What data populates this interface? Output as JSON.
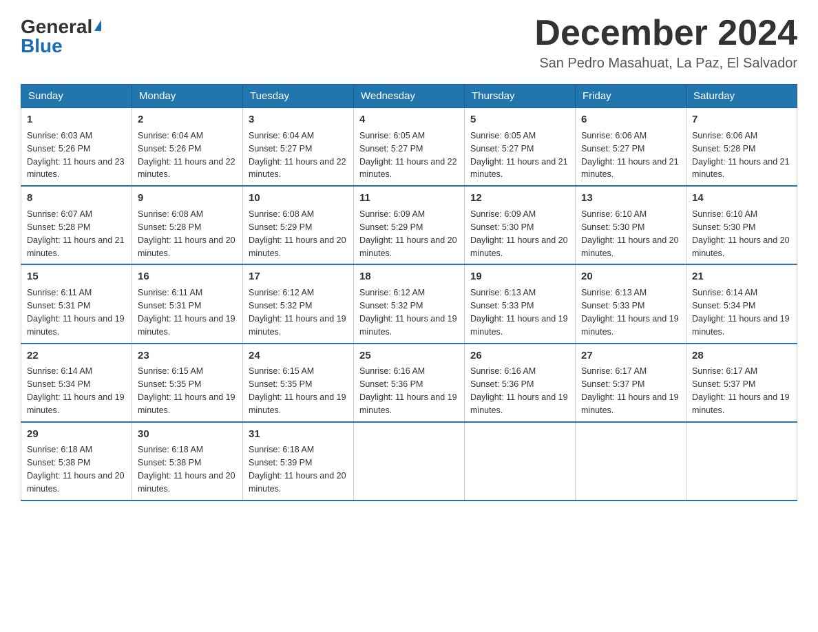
{
  "header": {
    "logo_general": "General",
    "logo_blue": "Blue",
    "title": "December 2024",
    "subtitle": "San Pedro Masahuat, La Paz, El Salvador"
  },
  "weekdays": [
    "Sunday",
    "Monday",
    "Tuesday",
    "Wednesday",
    "Thursday",
    "Friday",
    "Saturday"
  ],
  "weeks": [
    [
      {
        "day": "1",
        "sunrise": "6:03 AM",
        "sunset": "5:26 PM",
        "daylight": "11 hours and 23 minutes."
      },
      {
        "day": "2",
        "sunrise": "6:04 AM",
        "sunset": "5:26 PM",
        "daylight": "11 hours and 22 minutes."
      },
      {
        "day": "3",
        "sunrise": "6:04 AM",
        "sunset": "5:27 PM",
        "daylight": "11 hours and 22 minutes."
      },
      {
        "day": "4",
        "sunrise": "6:05 AM",
        "sunset": "5:27 PM",
        "daylight": "11 hours and 22 minutes."
      },
      {
        "day": "5",
        "sunrise": "6:05 AM",
        "sunset": "5:27 PM",
        "daylight": "11 hours and 21 minutes."
      },
      {
        "day": "6",
        "sunrise": "6:06 AM",
        "sunset": "5:27 PM",
        "daylight": "11 hours and 21 minutes."
      },
      {
        "day": "7",
        "sunrise": "6:06 AM",
        "sunset": "5:28 PM",
        "daylight": "11 hours and 21 minutes."
      }
    ],
    [
      {
        "day": "8",
        "sunrise": "6:07 AM",
        "sunset": "5:28 PM",
        "daylight": "11 hours and 21 minutes."
      },
      {
        "day": "9",
        "sunrise": "6:08 AM",
        "sunset": "5:28 PM",
        "daylight": "11 hours and 20 minutes."
      },
      {
        "day": "10",
        "sunrise": "6:08 AM",
        "sunset": "5:29 PM",
        "daylight": "11 hours and 20 minutes."
      },
      {
        "day": "11",
        "sunrise": "6:09 AM",
        "sunset": "5:29 PM",
        "daylight": "11 hours and 20 minutes."
      },
      {
        "day": "12",
        "sunrise": "6:09 AM",
        "sunset": "5:30 PM",
        "daylight": "11 hours and 20 minutes."
      },
      {
        "day": "13",
        "sunrise": "6:10 AM",
        "sunset": "5:30 PM",
        "daylight": "11 hours and 20 minutes."
      },
      {
        "day": "14",
        "sunrise": "6:10 AM",
        "sunset": "5:30 PM",
        "daylight": "11 hours and 20 minutes."
      }
    ],
    [
      {
        "day": "15",
        "sunrise": "6:11 AM",
        "sunset": "5:31 PM",
        "daylight": "11 hours and 19 minutes."
      },
      {
        "day": "16",
        "sunrise": "6:11 AM",
        "sunset": "5:31 PM",
        "daylight": "11 hours and 19 minutes."
      },
      {
        "day": "17",
        "sunrise": "6:12 AM",
        "sunset": "5:32 PM",
        "daylight": "11 hours and 19 minutes."
      },
      {
        "day": "18",
        "sunrise": "6:12 AM",
        "sunset": "5:32 PM",
        "daylight": "11 hours and 19 minutes."
      },
      {
        "day": "19",
        "sunrise": "6:13 AM",
        "sunset": "5:33 PM",
        "daylight": "11 hours and 19 minutes."
      },
      {
        "day": "20",
        "sunrise": "6:13 AM",
        "sunset": "5:33 PM",
        "daylight": "11 hours and 19 minutes."
      },
      {
        "day": "21",
        "sunrise": "6:14 AM",
        "sunset": "5:34 PM",
        "daylight": "11 hours and 19 minutes."
      }
    ],
    [
      {
        "day": "22",
        "sunrise": "6:14 AM",
        "sunset": "5:34 PM",
        "daylight": "11 hours and 19 minutes."
      },
      {
        "day": "23",
        "sunrise": "6:15 AM",
        "sunset": "5:35 PM",
        "daylight": "11 hours and 19 minutes."
      },
      {
        "day": "24",
        "sunrise": "6:15 AM",
        "sunset": "5:35 PM",
        "daylight": "11 hours and 19 minutes."
      },
      {
        "day": "25",
        "sunrise": "6:16 AM",
        "sunset": "5:36 PM",
        "daylight": "11 hours and 19 minutes."
      },
      {
        "day": "26",
        "sunrise": "6:16 AM",
        "sunset": "5:36 PM",
        "daylight": "11 hours and 19 minutes."
      },
      {
        "day": "27",
        "sunrise": "6:17 AM",
        "sunset": "5:37 PM",
        "daylight": "11 hours and 19 minutes."
      },
      {
        "day": "28",
        "sunrise": "6:17 AM",
        "sunset": "5:37 PM",
        "daylight": "11 hours and 19 minutes."
      }
    ],
    [
      {
        "day": "29",
        "sunrise": "6:18 AM",
        "sunset": "5:38 PM",
        "daylight": "11 hours and 20 minutes."
      },
      {
        "day": "30",
        "sunrise": "6:18 AM",
        "sunset": "5:38 PM",
        "daylight": "11 hours and 20 minutes."
      },
      {
        "day": "31",
        "sunrise": "6:18 AM",
        "sunset": "5:39 PM",
        "daylight": "11 hours and 20 minutes."
      },
      null,
      null,
      null,
      null
    ]
  ]
}
